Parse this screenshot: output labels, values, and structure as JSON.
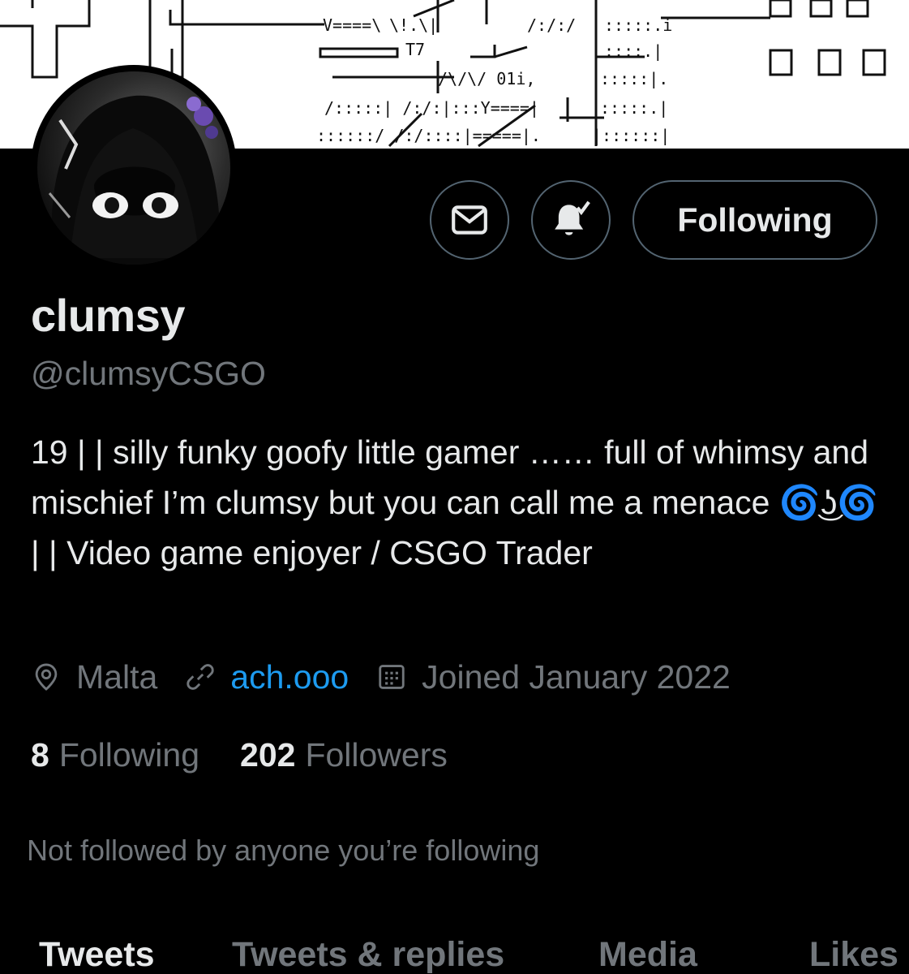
{
  "profile": {
    "display_name": "clumsy",
    "handle": "@clumsyCSGO",
    "bio": "19 | | silly funky goofy little gamer …… full of whimsy and mischief I’m clumsy but you can call me a menace 🌀͜ʖ🌀 | | Video game enjoyer / CSGO Trader",
    "location": "Malta",
    "website": "ach.ooo",
    "joined": "Joined January 2022"
  },
  "actions": {
    "message_icon": "mail-icon",
    "notify_icon": "bell-check-icon",
    "follow_label": "Following"
  },
  "stats": {
    "following_count": "8",
    "following_label": "Following",
    "followers_count": "202",
    "followers_label": "Followers"
  },
  "followed_by_note": "Not followed by anyone you’re following",
  "tabs": [
    {
      "label": "Tweets",
      "active": true
    },
    {
      "label": "Tweets & replies",
      "active": false
    },
    {
      "label": "Media",
      "active": false
    },
    {
      "label": "Likes",
      "active": false
    }
  ],
  "colors": {
    "background": "#000000",
    "primary_text": "#e7e9ea",
    "secondary_text": "#71767b",
    "link": "#1d9bf0",
    "border": "#536471"
  }
}
